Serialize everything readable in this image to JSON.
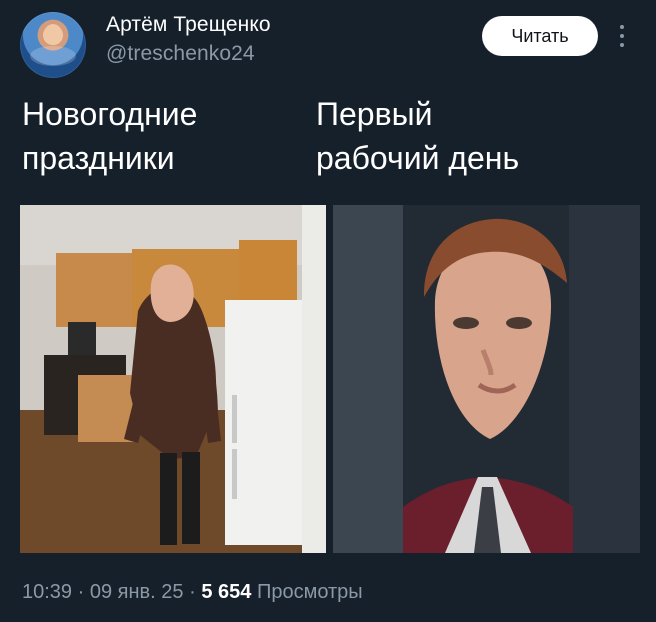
{
  "tweet": {
    "author_name": "Артём Трещенко",
    "author_handle": "@treschenko24",
    "follow_button": "Читать",
    "caption_left": "Новогодние\nпраздники",
    "caption_right": "Первый\nрабочий день",
    "time": "10:39",
    "date": "09 янв. 25",
    "separator": "·",
    "views_count": "5 654",
    "views_label": "Просмотры"
  },
  "icons": {
    "avatar": "avatar",
    "more": "more-options-icon"
  },
  "colors": {
    "background": "#15202b",
    "text": "#ffffff",
    "secondary_text": "#8b98a5",
    "button_bg": "#ffffff",
    "button_text": "#0f1419"
  }
}
